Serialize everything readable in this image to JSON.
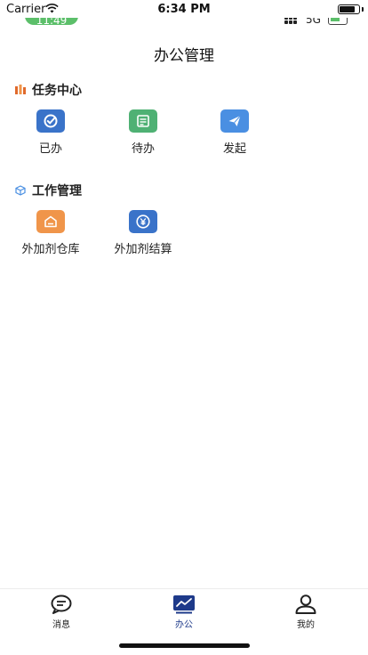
{
  "status_bar": {
    "carrier": "Carrier",
    "time": "6:34 PM"
  },
  "inner_status": {
    "time": "11:49",
    "network": "5G"
  },
  "page": {
    "title": "办公管理"
  },
  "sections": [
    {
      "title": "任务中心",
      "icon": "task-center-icon",
      "items": [
        {
          "label": "已办",
          "icon": "check-circle-icon",
          "color": "#3a73c9"
        },
        {
          "label": "待办",
          "icon": "list-icon",
          "color": "#4fb174"
        },
        {
          "label": "发起",
          "icon": "send-icon",
          "color": "#4a8fe2"
        }
      ]
    },
    {
      "title": "工作管理",
      "icon": "cube-icon",
      "items": [
        {
          "label": "外加剂仓库",
          "icon": "warehouse-icon",
          "color": "#f0954a"
        },
        {
          "label": "外加剂结算",
          "icon": "yen-icon",
          "color": "#3a73c9"
        }
      ]
    }
  ],
  "tab_bar": {
    "tabs": [
      {
        "label": "消息",
        "icon": "message-icon"
      },
      {
        "label": "办公",
        "icon": "office-icon",
        "active": true
      },
      {
        "label": "我的",
        "icon": "profile-icon"
      }
    ],
    "active_color": "#1e3a8a"
  }
}
